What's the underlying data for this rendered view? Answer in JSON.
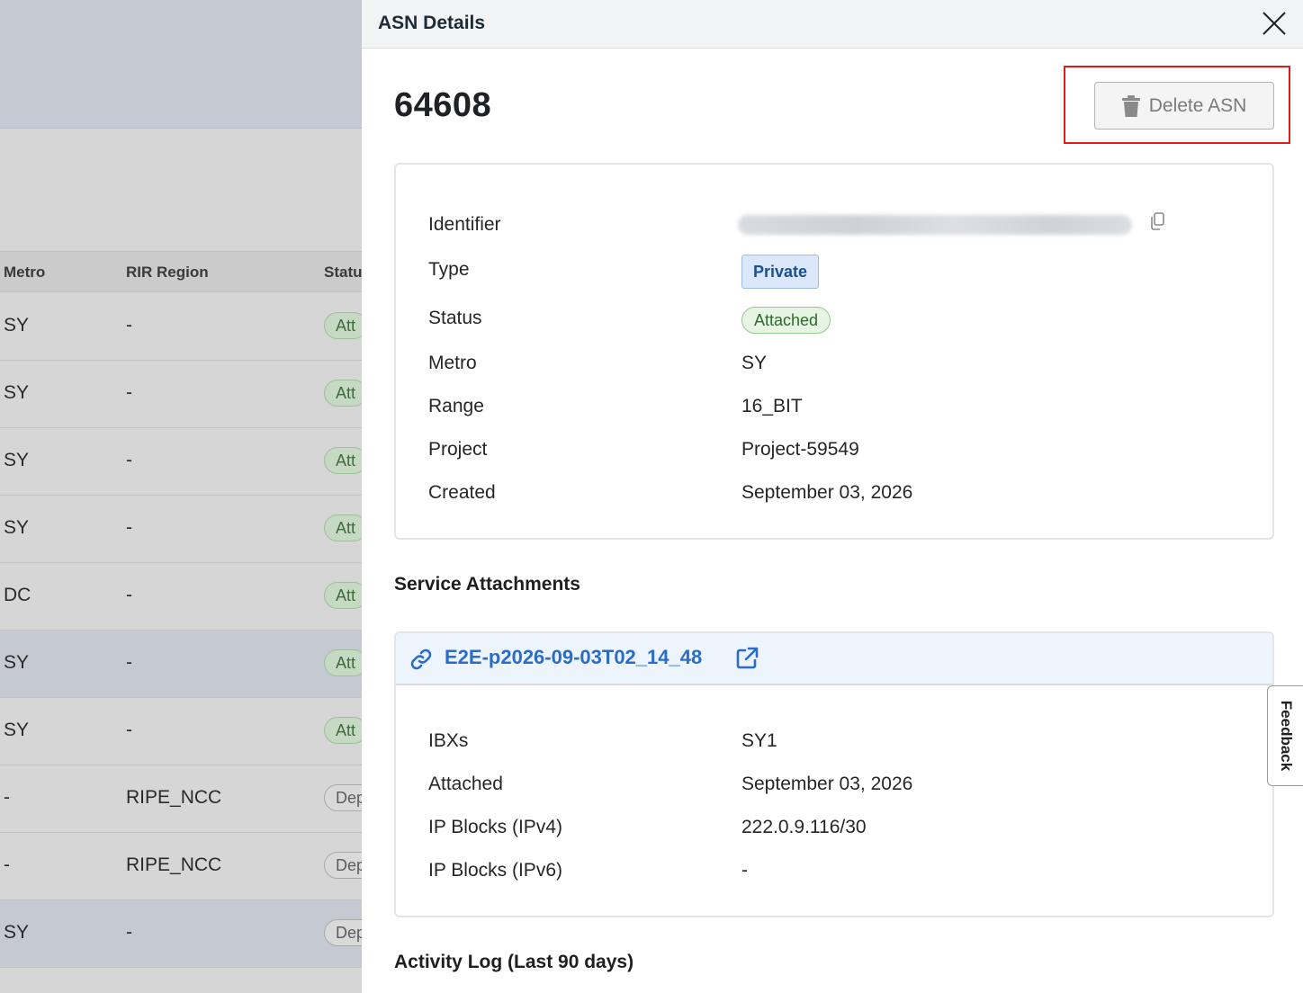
{
  "background_table": {
    "headers": {
      "metro": "Metro",
      "rir_region": "RIR Region",
      "status": "Statu"
    },
    "rows": [
      {
        "metro": "SY",
        "rir": "-",
        "status": "Att",
        "kind": "att"
      },
      {
        "metro": "SY",
        "rir": "-",
        "status": "Att",
        "kind": "att"
      },
      {
        "metro": "SY",
        "rir": "-",
        "status": "Att",
        "kind": "att"
      },
      {
        "metro": "SY",
        "rir": "-",
        "status": "Att",
        "kind": "att"
      },
      {
        "metro": "DC",
        "rir": "-",
        "status": "Att",
        "kind": "att"
      },
      {
        "metro": "SY",
        "rir": "-",
        "status": "Att",
        "kind": "att",
        "highlighted": true
      },
      {
        "metro": "SY",
        "rir": "-",
        "status": "Att",
        "kind": "att"
      },
      {
        "metro": "-",
        "rir": "RIPE_NCC",
        "status": "Dep",
        "kind": "dep"
      },
      {
        "metro": "-",
        "rir": "RIPE_NCC",
        "status": "Dep",
        "kind": "dep"
      },
      {
        "metro": "SY",
        "rir": "-",
        "status": "Dep",
        "kind": "dep",
        "highlighted": true
      }
    ]
  },
  "drawer": {
    "title": "ASN Details",
    "close_icon": "close-icon",
    "asn_number": "64608",
    "delete_button": {
      "label": "Delete ASN",
      "icon": "trash-icon"
    },
    "details": {
      "identifier_label": "Identifier",
      "type_label": "Type",
      "type_value": "Private",
      "status_label": "Status",
      "status_value": "Attached",
      "metro_label": "Metro",
      "metro_value": "SY",
      "range_label": "Range",
      "range_value": "16_BIT",
      "project_label": "Project",
      "project_value": "Project-59549",
      "created_label": "Created",
      "created_value": "September 03, 2026"
    },
    "service_attachments": {
      "title": "Service Attachments",
      "link_text": "E2E-p2026-09-03T02_14_48",
      "ibxs_label": "IBXs",
      "ibxs_value": "SY1",
      "attached_label": "Attached",
      "attached_value": "September 03, 2026",
      "ipv4_label": "IP Blocks (IPv4)",
      "ipv4_value": "222.0.9.116/30",
      "ipv6_label": "IP Blocks (IPv6)",
      "ipv6_value": "-"
    },
    "activity_log_title": "Activity Log (Last 90 days)"
  },
  "feedback_label": "Feedback",
  "colors": {
    "accent": "#2a6cc7",
    "highlight": "#e01b1b",
    "attached": "#2d6a2c"
  }
}
